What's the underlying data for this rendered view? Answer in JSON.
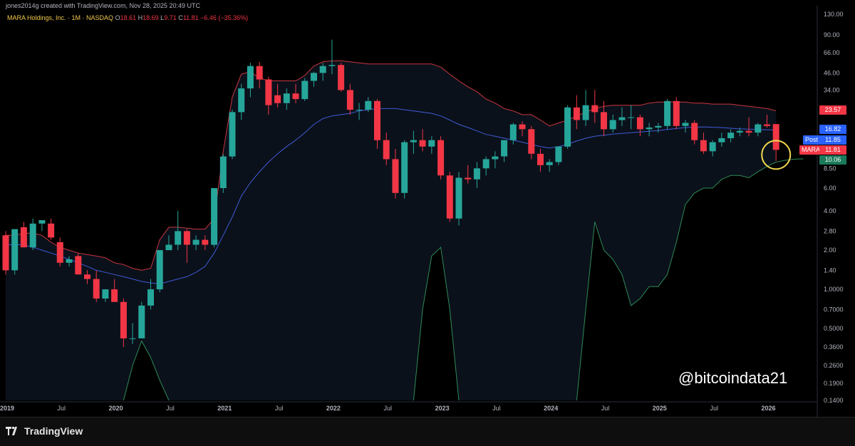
{
  "caption": "jones2014g created with TradingView.com, Nov 28, 2025 20:49 UTC",
  "legend": {
    "symbol": "MARA Holdings, Inc. · 1M · NASDAQ",
    "o_label": "O",
    "o_value": "18.61",
    "h_label": "H",
    "h_value": "18.69",
    "l_label": "L",
    "l_value": "9.71",
    "c_label": "C",
    "c_value": "11.81",
    "change": "−6.46 (−35.36%)"
  },
  "price_tags": {
    "upper": "23.57",
    "middle": "16.82",
    "post_label": "Post",
    "post": "11.85",
    "mara_label": "MARA",
    "mara": "11.81",
    "lower": "10.06"
  },
  "watermark": "@bitcoindata21",
  "brand": "TradingView",
  "colors": {
    "up": "#26a69a",
    "down": "#f23645",
    "upper_band": "#c9363f",
    "middle_band": "#3f5ad6",
    "lower_band": "#2e8b57",
    "circle": "#f2d94e",
    "post_tag": "#2962ff"
  },
  "chart_data": {
    "type": "candlestick",
    "title": "MARA Holdings, Inc. · 1M · NASDAQ",
    "scale": "log",
    "y_ticks": [
      "130.00",
      "90.00",
      "66.00",
      "46.00",
      "34.00",
      "23.57",
      "16.82",
      "11.85",
      "11.81",
      "10.06",
      "8.50",
      "6.00",
      "4.00",
      "2.80",
      "2.00",
      "1.40",
      "1.0000",
      "0.7000",
      "0.5000",
      "0.3600",
      "0.2600",
      "0.1900",
      "0.1400"
    ],
    "x_ticks": [
      "2019",
      "Jul",
      "2020",
      "Jul",
      "2021",
      "Jul",
      "2022",
      "Jul",
      "2023",
      "Jul",
      "2024",
      "Jul",
      "2025",
      "Jul",
      "2026"
    ],
    "ylim": [
      0.14,
      130
    ],
    "grid": false,
    "candles": [
      {
        "o": 2.6,
        "h": 2.8,
        "l": 1.3,
        "c": 1.4
      },
      {
        "o": 1.4,
        "h": 2.9,
        "l": 1.3,
        "c": 2.9
      },
      {
        "o": 3.0,
        "h": 3.3,
        "l": 2.2,
        "c": 2.1
      },
      {
        "o": 2.1,
        "h": 3.5,
        "l": 2.0,
        "c": 3.2
      },
      {
        "o": 3.2,
        "h": 3.4,
        "l": 2.8,
        "c": 3.4
      },
      {
        "o": 3.2,
        "h": 3.5,
        "l": 2.4,
        "c": 2.5
      },
      {
        "o": 2.3,
        "h": 2.5,
        "l": 1.5,
        "c": 1.6
      },
      {
        "o": 1.6,
        "h": 1.8,
        "l": 1.5,
        "c": 1.7
      },
      {
        "o": 1.8,
        "h": 1.9,
        "l": 1.3,
        "c": 1.3
      },
      {
        "o": 1.3,
        "h": 1.4,
        "l": 1.1,
        "c": 1.2
      },
      {
        "o": 1.2,
        "h": 1.4,
        "l": 0.8,
        "c": 0.85
      },
      {
        "o": 0.85,
        "h": 1.0,
        "l": 0.8,
        "c": 1.0
      },
      {
        "o": 1.0,
        "h": 1.2,
        "l": 0.8,
        "c": 0.8
      },
      {
        "o": 0.8,
        "h": 0.85,
        "l": 0.36,
        "c": 0.42
      },
      {
        "o": 0.42,
        "h": 0.55,
        "l": 0.38,
        "c": 0.42
      },
      {
        "o": 0.42,
        "h": 0.8,
        "l": 0.42,
        "c": 0.75
      },
      {
        "o": 0.75,
        "h": 1.2,
        "l": 0.7,
        "c": 1.0
      },
      {
        "o": 1.0,
        "h": 2.0,
        "l": 0.95,
        "c": 2.0
      },
      {
        "o": 2.0,
        "h": 2.6,
        "l": 2.0,
        "c": 2.2
      },
      {
        "o": 2.2,
        "h": 4.0,
        "l": 2.0,
        "c": 2.8
      },
      {
        "o": 2.8,
        "h": 2.9,
        "l": 1.6,
        "c": 2.2
      },
      {
        "o": 2.2,
        "h": 2.6,
        "l": 2.0,
        "c": 2.4
      },
      {
        "o": 2.4,
        "h": 2.6,
        "l": 2.0,
        "c": 2.2
      },
      {
        "o": 2.2,
        "h": 6.0,
        "l": 2.1,
        "c": 6.0
      },
      {
        "o": 6.0,
        "h": 11.0,
        "l": 5.5,
        "c": 10.5
      },
      {
        "o": 10.5,
        "h": 24.0,
        "l": 10.0,
        "c": 23.0
      },
      {
        "o": 23.0,
        "h": 38.0,
        "l": 20.0,
        "c": 35.0
      },
      {
        "o": 35.0,
        "h": 55.0,
        "l": 30.0,
        "c": 52.0
      },
      {
        "o": 52.0,
        "h": 56.0,
        "l": 35.0,
        "c": 41.0
      },
      {
        "o": 41.0,
        "h": 43.0,
        "l": 22.0,
        "c": 26.0
      },
      {
        "o": 31.0,
        "h": 38.0,
        "l": 25.0,
        "c": 27.0
      },
      {
        "o": 27.0,
        "h": 35.0,
        "l": 24.0,
        "c": 32.0
      },
      {
        "o": 32.0,
        "h": 38.0,
        "l": 27.0,
        "c": 29.0
      },
      {
        "o": 29.0,
        "h": 42.0,
        "l": 28.0,
        "c": 40.0
      },
      {
        "o": 40.0,
        "h": 47.0,
        "l": 36.0,
        "c": 46.0
      },
      {
        "o": 46.0,
        "h": 55.0,
        "l": 40.0,
        "c": 52.0
      },
      {
        "o": 52.0,
        "h": 83.0,
        "l": 45.0,
        "c": 53.0
      },
      {
        "o": 53.0,
        "h": 55.0,
        "l": 33.0,
        "c": 34.0
      },
      {
        "o": 34.0,
        "h": 38.0,
        "l": 22.0,
        "c": 24.0
      },
      {
        "o": 24.0,
        "h": 27.0,
        "l": 20.0,
        "c": 24.0
      },
      {
        "o": 24.0,
        "h": 30.0,
        "l": 23.0,
        "c": 28.0
      },
      {
        "o": 28.0,
        "h": 29.0,
        "l": 12.0,
        "c": 14.0
      },
      {
        "o": 14.0,
        "h": 16.0,
        "l": 9.0,
        "c": 10.0
      },
      {
        "o": 10.0,
        "h": 12.0,
        "l": 5.0,
        "c": 5.5
      },
      {
        "o": 5.5,
        "h": 14.0,
        "l": 5.0,
        "c": 13.5
      },
      {
        "o": 13.5,
        "h": 16.5,
        "l": 11.0,
        "c": 14.0
      },
      {
        "o": 14.0,
        "h": 17.0,
        "l": 11.5,
        "c": 12.5
      },
      {
        "o": 12.5,
        "h": 15.0,
        "l": 11.0,
        "c": 14.0
      },
      {
        "o": 14.0,
        "h": 15.0,
        "l": 7.0,
        "c": 7.5
      },
      {
        "o": 7.5,
        "h": 8.0,
        "l": 3.3,
        "c": 3.5
      },
      {
        "o": 3.5,
        "h": 8.0,
        "l": 3.1,
        "c": 7.2
      },
      {
        "o": 7.2,
        "h": 9.0,
        "l": 6.5,
        "c": 7.0
      },
      {
        "o": 7.0,
        "h": 9.5,
        "l": 6.0,
        "c": 8.5
      },
      {
        "o": 8.5,
        "h": 10.5,
        "l": 7.5,
        "c": 10.0
      },
      {
        "o": 10.0,
        "h": 11.5,
        "l": 8.5,
        "c": 10.5
      },
      {
        "o": 10.5,
        "h": 14.0,
        "l": 9.5,
        "c": 14.0
      },
      {
        "o": 14.0,
        "h": 19.0,
        "l": 13.0,
        "c": 18.5
      },
      {
        "o": 18.5,
        "h": 19.5,
        "l": 15.0,
        "c": 17.0
      },
      {
        "o": 17.0,
        "h": 18.0,
        "l": 10.0,
        "c": 11.0
      },
      {
        "o": 11.0,
        "h": 12.0,
        "l": 8.0,
        "c": 9.0
      },
      {
        "o": 9.0,
        "h": 10.0,
        "l": 8.0,
        "c": 9.5
      },
      {
        "o": 9.5,
        "h": 12.0,
        "l": 9.0,
        "c": 12.5
      },
      {
        "o": 12.5,
        "h": 26.0,
        "l": 12.0,
        "c": 25.0
      },
      {
        "o": 25.0,
        "h": 31.0,
        "l": 17.0,
        "c": 20.0
      },
      {
        "o": 20.0,
        "h": 34.0,
        "l": 18.0,
        "c": 26.0
      },
      {
        "o": 26.0,
        "h": 34.0,
        "l": 19.0,
        "c": 23.0
      },
      {
        "o": 23.0,
        "h": 28.0,
        "l": 15.0,
        "c": 17.0
      },
      {
        "o": 17.0,
        "h": 22.0,
        "l": 16.0,
        "c": 20.0
      },
      {
        "o": 20.0,
        "h": 25.0,
        "l": 18.0,
        "c": 21.0
      },
      {
        "o": 21.0,
        "h": 26.0,
        "l": 17.0,
        "c": 21.0
      },
      {
        "o": 21.0,
        "h": 22.0,
        "l": 15.0,
        "c": 17.0
      },
      {
        "o": 17.0,
        "h": 19.0,
        "l": 15.0,
        "c": 17.5
      },
      {
        "o": 17.5,
        "h": 19.0,
        "l": 16.0,
        "c": 18.0
      },
      {
        "o": 18.0,
        "h": 29.0,
        "l": 17.0,
        "c": 28.0
      },
      {
        "o": 28.0,
        "h": 30.0,
        "l": 17.0,
        "c": 18.0
      },
      {
        "o": 18.0,
        "h": 20.0,
        "l": 16.0,
        "c": 19.0
      },
      {
        "o": 19.0,
        "h": 20.0,
        "l": 13.0,
        "c": 14.0
      },
      {
        "o": 14.0,
        "h": 16.0,
        "l": 11.0,
        "c": 11.5
      },
      {
        "o": 11.5,
        "h": 14.0,
        "l": 10.5,
        "c": 13.5
      },
      {
        "o": 13.5,
        "h": 16.0,
        "l": 12.5,
        "c": 14.5
      },
      {
        "o": 14.5,
        "h": 17.0,
        "l": 13.5,
        "c": 16.0
      },
      {
        "o": 16.0,
        "h": 17.5,
        "l": 15.0,
        "c": 16.5
      },
      {
        "o": 16.5,
        "h": 21.0,
        "l": 15.0,
        "c": 16.0
      },
      {
        "o": 16.0,
        "h": 19.0,
        "l": 15.0,
        "c": 18.5
      },
      {
        "o": 18.5,
        "h": 22.0,
        "l": 17.5,
        "c": 18.0
      },
      {
        "o": 18.61,
        "h": 18.69,
        "l": 9.71,
        "c": 11.81
      }
    ],
    "upper_band": [
      2.6,
      2.6,
      2.7,
      2.7,
      2.6,
      2.3,
      2.1,
      2.0,
      1.9,
      1.85,
      1.8,
      1.75,
      1.6,
      1.55,
      1.45,
      1.4,
      1.45,
      2.4,
      3.0,
      3.0,
      2.95,
      2.9,
      2.9,
      3.5,
      11.5,
      30.0,
      45.0,
      47.0,
      42.0,
      40.0,
      40.0,
      40.0,
      40.0,
      44.0,
      52.0,
      56.0,
      57.0,
      57.0,
      56.0,
      55.0,
      54.0,
      54.0,
      54.0,
      54.0,
      54.0,
      54.0,
      54.0,
      54.0,
      51.0,
      45.0,
      40.0,
      36.0,
      33.0,
      29.0,
      27.0,
      24.5,
      23.5,
      22.0,
      22.0,
      20.0,
      18.0,
      19.0,
      20.0,
      21.5,
      23.0,
      24.5,
      25.5,
      26.0,
      26.0,
      26.0,
      26.0,
      27.0,
      27.5,
      27.5,
      27.5,
      27.5,
      27.0,
      27.0,
      26.5,
      26.5,
      26.5,
      26.0,
      25.5,
      25.0,
      24.5,
      23.57
    ],
    "middle_band": [
      2.2,
      2.2,
      2.2,
      2.1,
      2.0,
      1.9,
      1.8,
      1.7,
      1.6,
      1.5,
      1.4,
      1.35,
      1.3,
      1.25,
      1.2,
      1.15,
      1.12,
      1.1,
      1.15,
      1.2,
      1.25,
      1.35,
      1.5,
      1.9,
      2.6,
      3.6,
      5.2,
      6.6,
      8.0,
      9.5,
      11.0,
      12.5,
      14.0,
      16.0,
      18.5,
      20.5,
      21.5,
      22.0,
      22.5,
      23.5,
      24.0,
      24.5,
      24.5,
      24.5,
      24.0,
      23.5,
      23.0,
      22.5,
      21.5,
      20.0,
      18.5,
      17.5,
      16.5,
      15.5,
      15.0,
      14.5,
      14.0,
      13.5,
      13.0,
      12.5,
      12.2,
      12.5,
      13.0,
      13.8,
      14.5,
      15.0,
      15.3,
      15.6,
      15.8,
      16.0,
      16.2,
      16.4,
      16.6,
      16.9,
      17.2,
      17.5,
      17.6,
      17.7,
      17.6,
      17.5,
      17.3,
      17.1,
      17.0,
      16.9,
      16.8,
      16.82
    ],
    "lower_band": [
      0.14,
      0.14,
      0.14,
      0.14,
      0.14,
      0.14,
      0.14,
      0.14,
      0.14,
      0.14,
      0.14,
      0.14,
      0.14,
      0.14,
      0.14,
      0.24,
      0.4,
      0.3,
      0.2,
      0.14,
      0.14,
      0.14,
      0.14,
      0.14,
      0.14,
      0.14,
      0.14,
      0.14,
      0.14,
      0.14,
      0.14,
      0.14,
      0.14,
      0.14,
      0.14,
      0.14,
      0.14,
      0.14,
      0.14,
      0.14,
      0.14,
      0.14,
      0.14,
      0.14,
      0.14,
      0.14,
      0.14,
      0.14,
      0.14,
      0.14,
      0.14,
      0.14,
      0.14,
      0.14,
      0.14,
      0.14,
      0.14,
      0.14,
      0.14,
      0.14,
      0.14,
      0.14,
      0.14,
      0.14,
      0.14,
      0.14,
      0.14,
      0.14,
      0.14,
      0.14,
      0.14,
      0.14,
      0.14,
      0.14,
      0.14,
      0.14,
      0.14,
      0.14,
      0.14,
      0.14,
      0.14,
      0.14,
      0.14,
      0.14,
      0.14,
      0.14
    ],
    "lower_band_segments": [
      {
        "start": 13,
        "values": [
          0.14,
          0.26,
          0.4,
          0.3,
          0.2,
          0.14
        ]
      },
      {
        "start": 45,
        "values": [
          0.14,
          0.7,
          1.8,
          2.1,
          0.7,
          0.14
        ]
      },
      {
        "start": 63,
        "values": [
          0.14,
          0.7,
          3.3,
          2.0,
          1.7,
          1.3,
          0.75,
          0.85,
          1.05,
          1.05,
          1.3,
          2.3,
          4.5,
          5.5,
          6.0,
          6.0,
          7.0,
          7.5,
          7.5,
          7.2,
          8.0,
          8.8,
          9.5,
          9.8,
          10.0,
          10.06
        ]
      }
    ]
  }
}
